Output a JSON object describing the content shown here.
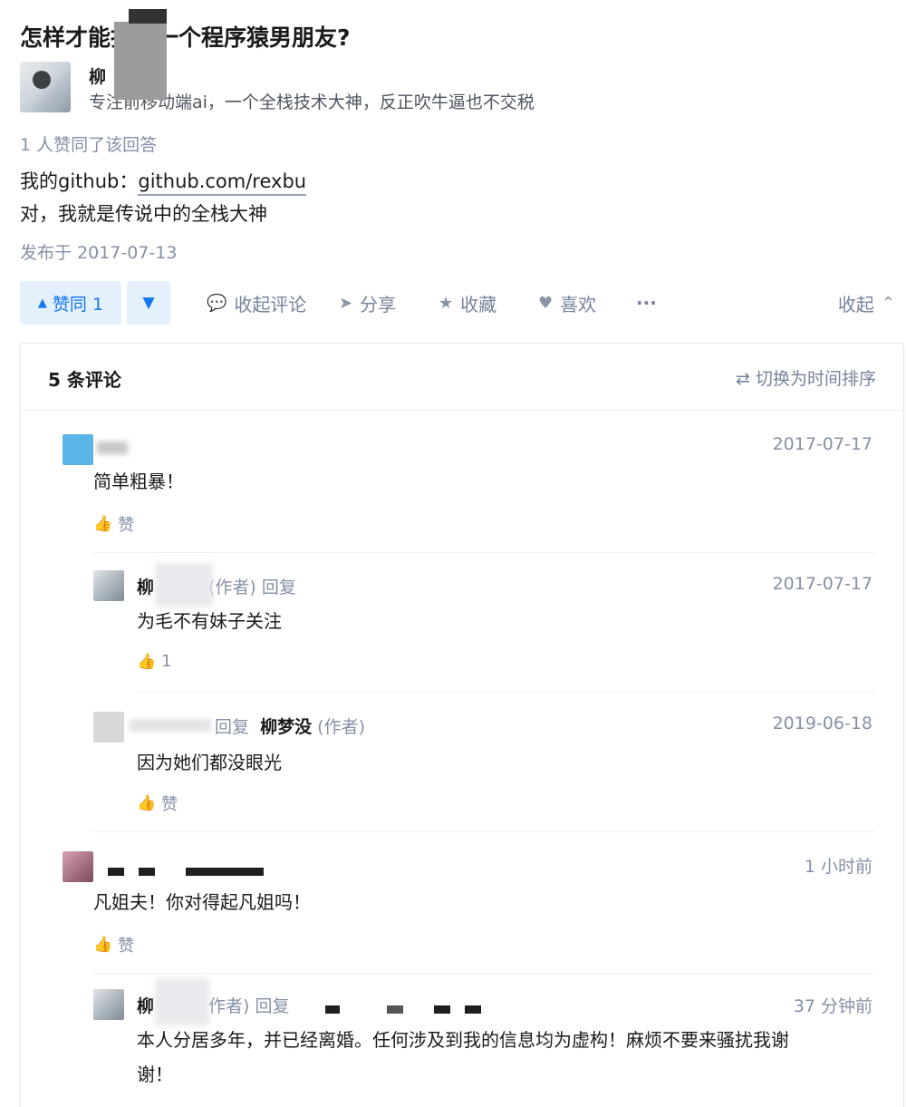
{
  "question": {
    "title": "怎样才能找到一个程序猿男朋友?"
  },
  "author": {
    "name": "柳",
    "bio": "专注前移动端ai，一个全栈技术大神，反正吹牛逼也不交税"
  },
  "answer": {
    "voters": "1 人赞同了该回答",
    "line1_prefix": "我的github：",
    "line1_link": "github.com/rexbu",
    "line2": "对，我就是传说中的全栈大神",
    "published": "发布于 2017-07-13"
  },
  "actions": {
    "vote_up": "赞同 1",
    "collapse_comments": "收起评论",
    "share": "分享",
    "favorite": "收藏",
    "like": "喜欢",
    "more": "···",
    "collapse": "收起"
  },
  "comments": {
    "count": "5 条评论",
    "switch": "切换为时间排序",
    "items": [
      {
        "name": "",
        "date": "2017-07-17",
        "text": "简单粗暴！",
        "like": "赞"
      },
      {
        "name": "柳",
        "author_tag": "(作者) 回复",
        "date": "2017-07-17",
        "text": "为毛不有妹子关注",
        "like": "1"
      },
      {
        "reply_prefix": "回复",
        "reply_to": "柳梦没",
        "author_tag": "(作者)",
        "date": "2019-06-18",
        "text": "因为她们都没眼光",
        "like": "赞"
      },
      {
        "name": "",
        "date": "1 小时前",
        "text": "凡姐夫！你对得起凡姐吗！",
        "like": "赞"
      },
      {
        "name": "柳",
        "author_tag": "作者) 回复",
        "date": "37 分钟前",
        "text_l1": "本人分居多年，并已经离婚。任何涉及到我的信息均为虚构！麻烦不要来骚扰我谢",
        "text_l2": "谢！"
      }
    ]
  },
  "colors": {
    "accent": "#0f78f0",
    "accent_bg": "#e5f0fd",
    "muted": "#8590a6"
  }
}
